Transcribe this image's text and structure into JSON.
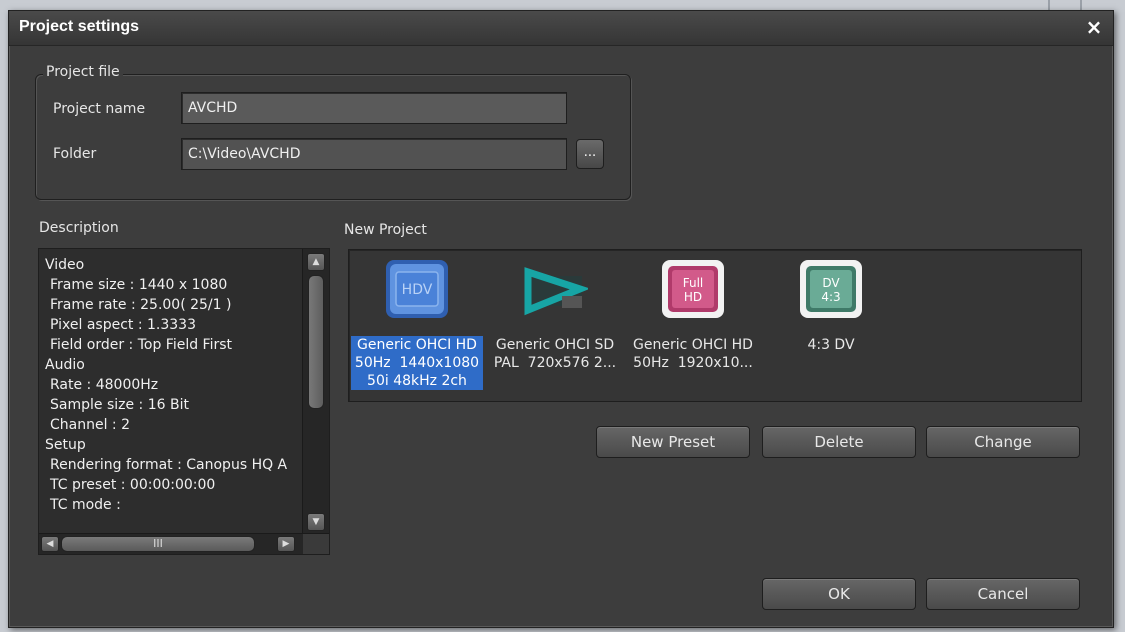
{
  "window": {
    "title": "Project settings",
    "close_glyph": "×"
  },
  "project_file": {
    "legend": "Project file",
    "name_label": "Project name",
    "name_value": "AVCHD",
    "folder_label": "Folder",
    "folder_value": "C:\\Video\\AVCHD",
    "browse_label": "..."
  },
  "description": {
    "label": "Description",
    "lines": [
      "Video",
      "Frame size : 1440 x 1080",
      "Frame rate : 25.00( 25/1 )",
      "Pixel aspect : 1.3333",
      "Field order : Top Field First",
      "Audio",
      "Rate : 48000Hz",
      "Sample size : 16 Bit",
      "Channel : 2",
      "Setup",
      "Rendering format : Canopus HQ A",
      "TC preset : 00:00:00:00",
      "TC mode :"
    ],
    "hscroll_grip": "III"
  },
  "new_project": {
    "label": "New Project",
    "presets": [
      {
        "icon": "hdv-icon",
        "badge": "HDV",
        "caption": "Generic OHCI HD\n50Hz  1440x1080\n50i 48kHz 2ch",
        "selected": true
      },
      {
        "icon": "sd-play-icon",
        "badge": "",
        "caption": "Generic OHCI SD\nPAL  720x576 2...",
        "selected": false
      },
      {
        "icon": "full-hd-icon",
        "badge": "Full\nHD",
        "caption": "Generic OHCI HD\n50Hz  1920x10...",
        "selected": false
      },
      {
        "icon": "dv-4-3-icon",
        "badge": "DV\n4:3",
        "caption": "4:3 DV",
        "selected": false
      }
    ]
  },
  "buttons": {
    "new_preset": "New Preset",
    "delete": "Delete",
    "change": "Change",
    "ok": "OK",
    "cancel": "Cancel"
  },
  "colors": {
    "selection": "#2f6cc8",
    "hdv": "#4a82d8",
    "sd": "#17a5a5",
    "full_hd": "#b03a6a",
    "dv": "#5a9a86"
  }
}
